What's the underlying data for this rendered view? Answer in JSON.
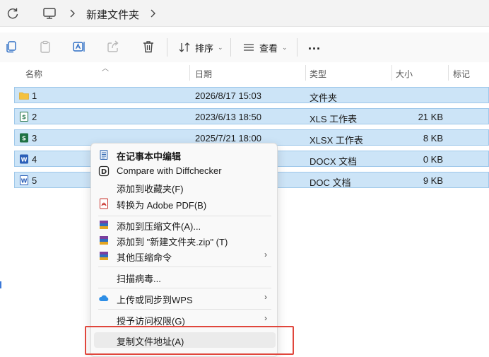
{
  "address_bar": {
    "breadcrumb": "新建文件夹"
  },
  "toolbar": {
    "sort_label": "排序",
    "view_label": "查看",
    "more_label": "..."
  },
  "columns": {
    "name": "名称",
    "date": "日期",
    "type": "类型",
    "size": "大小",
    "tags": "标记"
  },
  "files": [
    {
      "name": "1",
      "date": "2026/8/17 15:03",
      "type": "文件夹",
      "size": "",
      "icon": "folder-icon",
      "color": "#f4c13e"
    },
    {
      "name": "2",
      "date": "2023/6/13 18:50",
      "type": "XLS 工作表",
      "size": "21 KB",
      "icon": "xls-file-icon",
      "color": "#1f7244"
    },
    {
      "name": "3",
      "date": "2025/7/21 18:00",
      "type": "XLSX 工作表",
      "size": "8 KB",
      "icon": "xlsx-file-icon",
      "color": "#1f7244"
    },
    {
      "name": "4",
      "date": "",
      "type": "DOCX 文档",
      "size": "0 KB",
      "icon": "docx-file-icon",
      "color": "#2b5fb8"
    },
    {
      "name": "5",
      "date": "",
      "type": "DOC 文档",
      "size": "9 KB",
      "icon": "doc-file-icon",
      "color": "#2b5fb8"
    }
  ],
  "context_menu": {
    "items": [
      {
        "label": "在记事本中编辑",
        "icon": "notepad-icon"
      },
      {
        "label": "Compare with Diffchecker",
        "icon": "diffchecker-icon"
      },
      {
        "label": "添加到收藏夹(F)",
        "icon": ""
      },
      {
        "label": "转换为 Adobe PDF(B)",
        "icon": "adobe-pdf-icon"
      },
      {
        "label": "添加到压缩文件(A)...",
        "icon": "winrar-icon"
      },
      {
        "label": "添加到 \"新建文件夹.zip\" (T)",
        "icon": "winrar-icon"
      },
      {
        "label": "其他压缩命令",
        "icon": "winrar-icon"
      },
      {
        "label": "扫描病毒...",
        "icon": ""
      },
      {
        "label": "上传或同步到WPS",
        "icon": "wps-cloud-icon"
      },
      {
        "label": "授予访问权限(G)",
        "icon": ""
      },
      {
        "label": "复制文件地址(A)",
        "icon": ""
      }
    ],
    "submenu_arrow": "›"
  },
  "colors": {
    "selection_bg": "#cce4f7",
    "selection_border": "#9fc8ea",
    "highlight_box": "#e0463c"
  }
}
